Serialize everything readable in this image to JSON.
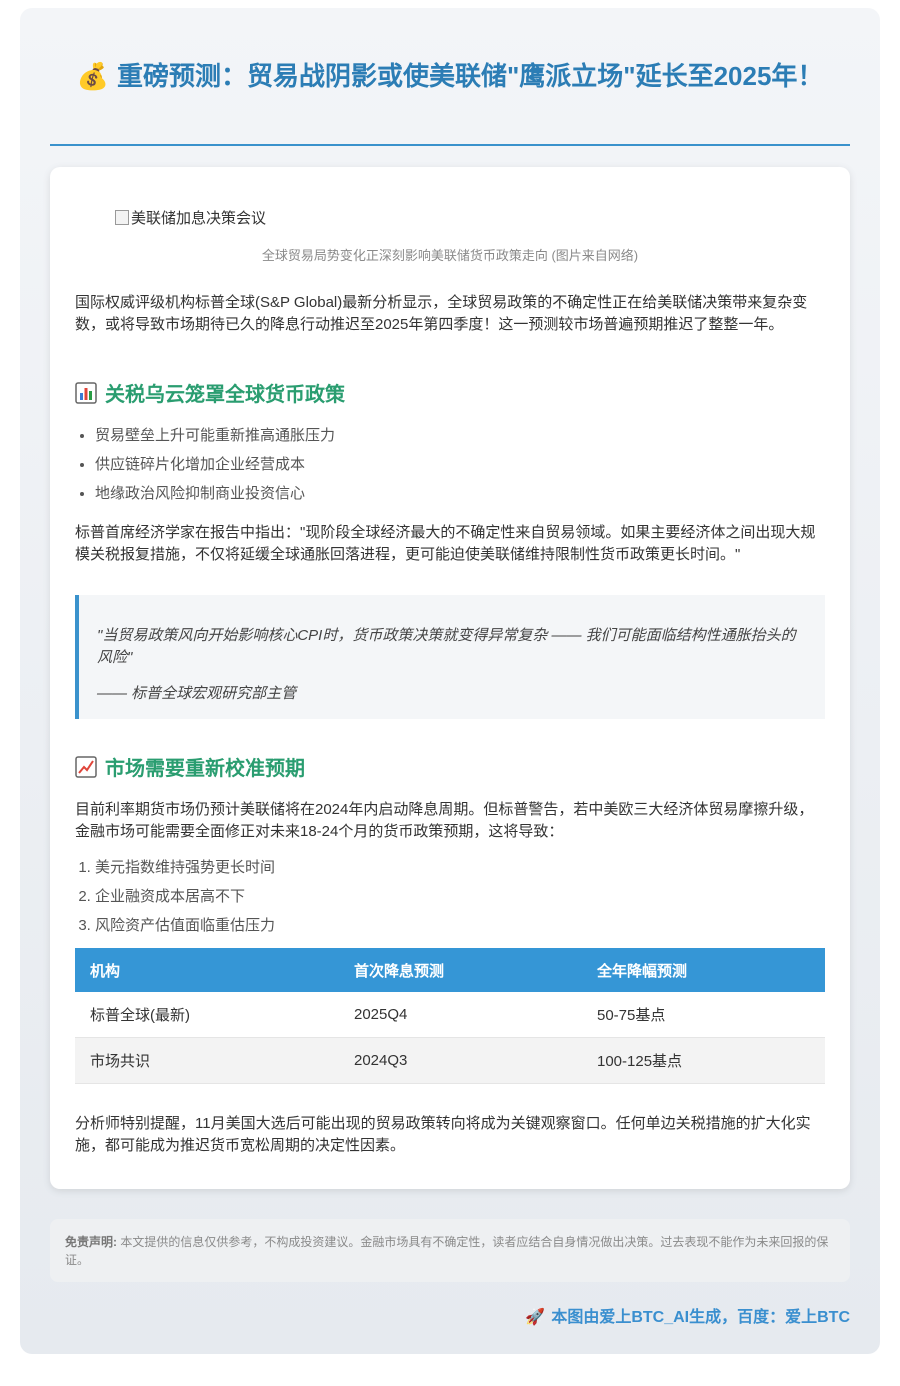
{
  "header": {
    "icon": "money-bag-icon",
    "title": "重磅预测：贸易战阴影或使美联储\"鹰派立场\"延长至2025年！"
  },
  "image": {
    "alt": "美联储加息决策会议",
    "caption": "全球贸易局势变化正深刻影响美联储货币政策走向 (图片来自网络)"
  },
  "intro": "国际权威评级机构标普全球(S&P Global)最新分析显示，全球贸易政策的不确定性正在给美联储决策带来复杂变数，或将导致市场期待已久的降息行动推迟至2025年第四季度！这一预测较市场普遍预期推迟了整整一年。",
  "section1": {
    "icon": "bar-chart-icon",
    "heading": "关税乌云笼罩全球货币政策",
    "bullets": [
      "贸易壁垒上升可能重新推高通胀压力",
      "供应链碎片化增加企业经营成本",
      "地缘政治风险抑制商业投资信心"
    ],
    "paragraph": "标普首席经济学家在报告中指出：\"现阶段全球经济最大的不确定性来自贸易领域。如果主要经济体之间出现大规模关税报复措施，不仅将延缓全球通胀回落进程，更可能迫使美联储维持限制性货币政策更长时间。\""
  },
  "quote": {
    "text": "\"当贸易政策风向开始影响核心CPI时，货币政策决策就变得异常复杂 —— 我们可能面临结构性通胀抬头的风险\"",
    "source": "—— 标普全球宏观研究部主管"
  },
  "section2": {
    "icon": "trend-up-icon",
    "heading": "市场需要重新校准预期",
    "paragraph": "目前利率期货市场仍预计美联储将在2024年内启动降息周期。但标普警告，若中美欧三大经济体贸易摩擦升级，金融市场可能需要全面修正对未来18-24个月的货币政策预期，这将导致：",
    "items": [
      "美元指数维持强势更长时间",
      "企业融资成本居高不下",
      "风险资产估值面临重估压力"
    ]
  },
  "table": {
    "headers": [
      "机构",
      "首次降息预测",
      "全年降幅预测"
    ],
    "rows": [
      [
        "标普全球(最新)",
        "2025Q4",
        "50-75基点"
      ],
      [
        "市场共识",
        "2024Q3",
        "100-125基点"
      ]
    ]
  },
  "closing": "分析师特别提醒，11月美国大选后可能出现的贸易政策转向将成为关键观察窗口。任何单边关税措施的扩大化实施，都可能成为推迟货币宽松周期的决定性因素。",
  "disclaimer": {
    "label": "免责声明:",
    "text": "本文提供的信息仅供参考，不构成投资建议。金融市场具有不确定性，读者应结合自身情况做出决策。过去表现不能作为未来回报的保证。"
  },
  "footer": {
    "icon": "rocket-icon",
    "text": "本图由爱上BTC_AI生成，百度：爱上BTC"
  },
  "colors": {
    "title": "#2c7db5",
    "section_heading": "#2a9d70",
    "accent": "#3596d6"
  }
}
